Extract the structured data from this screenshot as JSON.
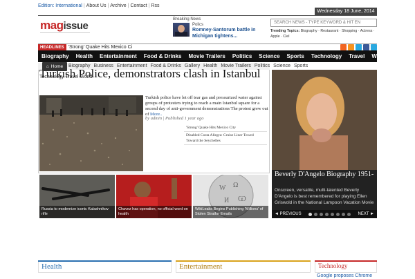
{
  "topbar": {
    "edition": "Edition: International",
    "links": [
      "About Us",
      "Archive",
      "Contact",
      "Rss"
    ]
  },
  "date": "Wednesday 18 June, 2014",
  "logo": {
    "part1": "mag",
    "part2": "issue"
  },
  "breaking": {
    "label": "Breaking News",
    "category": "Polics",
    "title": "Romney-Santorum battle in Michigan tightens..."
  },
  "search": {
    "placeholder": "SEARCH NEWS - TYPE KEYWORD & HIT EN"
  },
  "trending": {
    "label": "Trending Topics:",
    "items": "Biography · Restaurant · Shopping · Actress · Apple · Ciel"
  },
  "ticker": {
    "badge": "HEADLINES",
    "text": "'Strong' Quake Hits Mexico Ci"
  },
  "social_colors": {
    "rss": "#f26522",
    "rss2": "#f26522",
    "twitter": "#29a9e0",
    "facebook": "#3b5998",
    "other": "#2aa9e0"
  },
  "nav": {
    "items": [
      "Biography",
      "Health",
      "Entertainment",
      "Food & Drinks",
      "Movie Trailers",
      "Politics",
      "Science",
      "Sports",
      "Technology",
      "Travel",
      "World"
    ]
  },
  "subnav": {
    "home": "Home",
    "items": [
      "Biography",
      "Business",
      "Entertainment",
      "Food & Drinks",
      "Gallery",
      "Health",
      "Movie Trailers",
      "Politics",
      "Science",
      "Sports"
    ],
    "row2": "Technology  Travel  World"
  },
  "main": {
    "headline": "Turkish Police, demonstrators clash in Istanbul",
    "excerpt": "Turkish police have let off tear gas and pressurized water against groups of protesters trying to reach a main Istanbul square for a second day of anti-government demonstrations The protest grew out of",
    "more": "More..",
    "byline": "by admin | Published 1 year ago",
    "related": [
      "'Strong' Quake Hits Mexico City",
      "Disabled Costa Allegra: Cruise Liner Towed Toward the Seychelles"
    ]
  },
  "thumbs": [
    {
      "caption": "Russia to modernize iconic Kalashnikov rifle"
    },
    {
      "caption": "Chavez has operation, no official word on health"
    },
    {
      "caption": "WikiLeaks Begins Publishing 'Millions' of Stolen Stratfor Emails"
    }
  ],
  "slider": {
    "title": "Beverly D'Angelo Biography 1951-",
    "description": "Onscreen, versatile, multi-talented Beverly D'Angelo is best remembered for playing Ellen Griswold in the National Lampoon Vacation Movie",
    "prev": "◄ PREVIOUS",
    "next": "NEXT ►",
    "dots": 8,
    "active_dot": 0
  },
  "sections": [
    {
      "title": "Health",
      "color": "#2a6fb0",
      "text_color": "#2a6fb0"
    },
    {
      "title": "Entertainment",
      "color": "#d9a21b",
      "text_color": "#b07d10"
    },
    {
      "title": "Technology",
      "color": "#c62828",
      "text_color": "#c62828"
    }
  ],
  "sections_tech_item": "Google proposes Chrome"
}
